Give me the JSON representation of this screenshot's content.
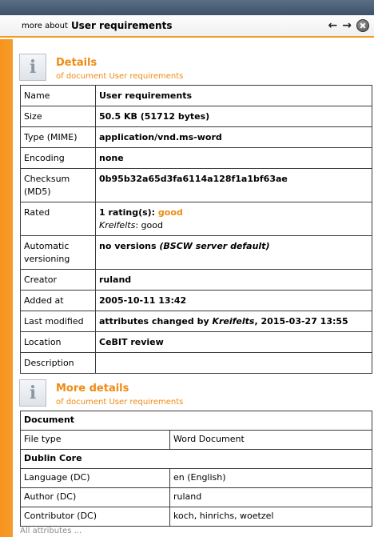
{
  "header": {
    "prefix": "more about",
    "title": "User requirements"
  },
  "details": {
    "title": "Details",
    "subtitle": "of document User requirements",
    "rows": {
      "name": {
        "label": "Name",
        "value": "User requirements"
      },
      "size": {
        "label": "Size",
        "value": "50.5 KB (51712 bytes)"
      },
      "type": {
        "label": "Type (MIME)",
        "value": "application/vnd.ms-word"
      },
      "encoding": {
        "label": "Encoding",
        "value": "none"
      },
      "checksum": {
        "label": "Checksum (MD5)",
        "value": "0b95b32a65d3fa6114a128f1a1bf63ae"
      },
      "rated": {
        "label": "Rated",
        "value_prefix": "1 rating(s):",
        "value_rating": "good",
        "rater": "Kreifelts",
        "rater_value": ": good"
      },
      "versioning": {
        "label": "Automatic versioning",
        "value": "no versions",
        "value_note": "(BSCW server default)"
      },
      "creator": {
        "label": "Creator",
        "value": "ruland"
      },
      "added": {
        "label": "Added at",
        "value": "2005-10-11 13:42"
      },
      "modified": {
        "label": "Last modified",
        "value_prefix": "attributes changed by",
        "value_user": "Kreifelts",
        "value_suffix": ", 2015-03-27 13:55"
      },
      "location": {
        "label": "Location",
        "value": "CeBIT review"
      },
      "description": {
        "label": "Description",
        "value": ""
      }
    }
  },
  "more_details": {
    "title": "More details",
    "subtitle": "of document User requirements",
    "group_document": "Document",
    "file_type": {
      "label": "File type",
      "value": "Word Document"
    },
    "group_dublin": "Dublin Core",
    "language": {
      "label": "Language (DC)",
      "value": "en (English)"
    },
    "author": {
      "label": "Author (DC)",
      "value": "ruland"
    },
    "contributor": {
      "label": "Contributor (DC)",
      "value": "koch, hinrichs, woetzel"
    }
  },
  "all_attributes": "All attributes ...",
  "icons": {
    "back": "←",
    "forward": "→",
    "info": "i"
  },
  "colors": {
    "accent": "#f08a12",
    "sidebar": "#f7941d",
    "topbar": "#4a5e75"
  }
}
